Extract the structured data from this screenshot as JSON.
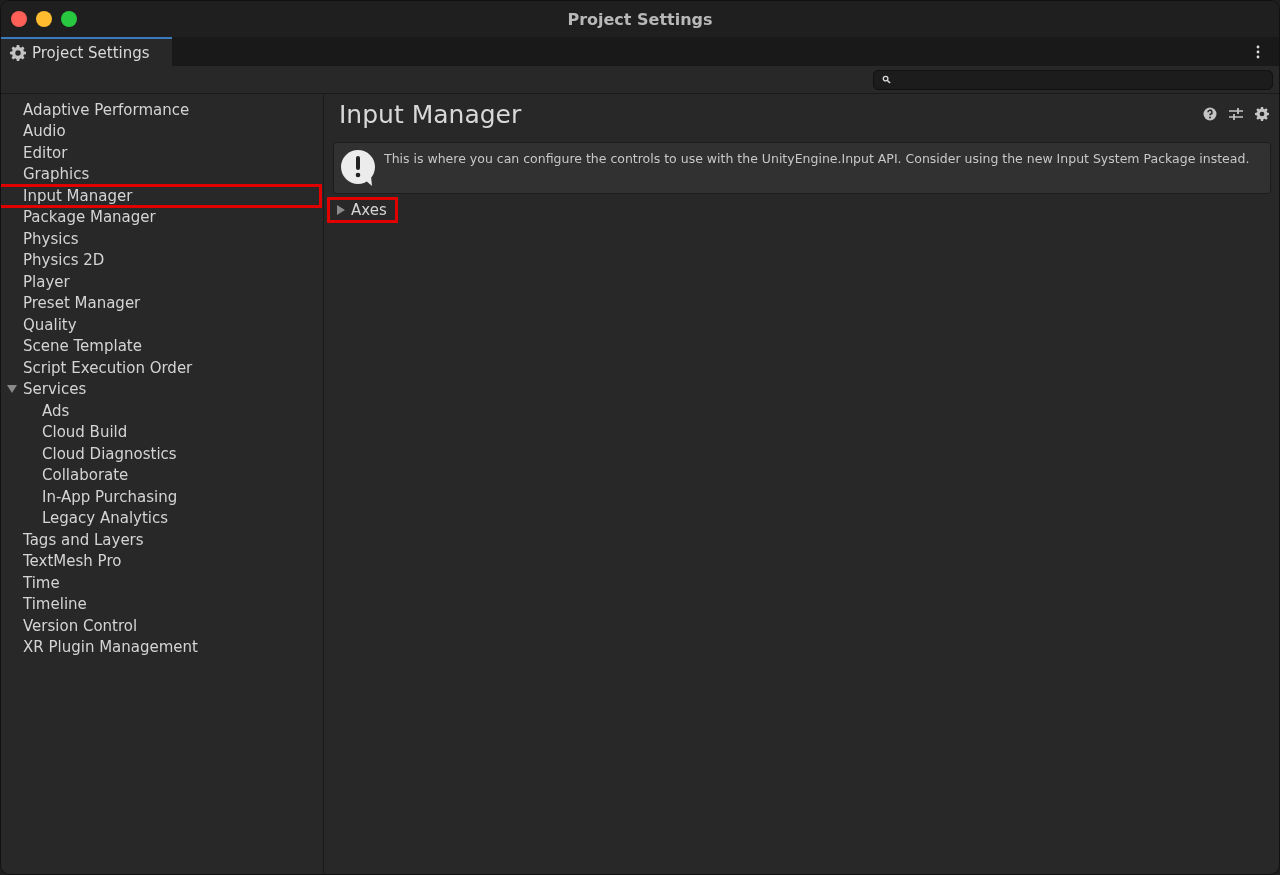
{
  "window": {
    "title": "Project Settings"
  },
  "tab": {
    "label": "Project Settings",
    "selected": true
  },
  "sidebar": {
    "items": [
      {
        "label": "Adaptive Performance",
        "highlighted": false
      },
      {
        "label": "Audio",
        "highlighted": false
      },
      {
        "label": "Editor",
        "highlighted": false
      },
      {
        "label": "Graphics",
        "highlighted": false
      },
      {
        "label": "Input Manager",
        "highlighted": true
      },
      {
        "label": "Package Manager",
        "highlighted": false
      },
      {
        "label": "Physics",
        "highlighted": false
      },
      {
        "label": "Physics 2D",
        "highlighted": false
      },
      {
        "label": "Player",
        "highlighted": false
      },
      {
        "label": "Preset Manager",
        "highlighted": false
      },
      {
        "label": "Quality",
        "highlighted": false
      },
      {
        "label": "Scene Template",
        "highlighted": false
      },
      {
        "label": "Script Execution Order",
        "highlighted": false
      },
      {
        "label": "Services",
        "highlighted": false,
        "expanded": true,
        "children": [
          {
            "label": "Ads",
            "highlighted": false
          },
          {
            "label": "Cloud Build",
            "highlighted": false
          },
          {
            "label": "Cloud Diagnostics",
            "highlighted": false
          },
          {
            "label": "Collaborate",
            "highlighted": false
          },
          {
            "label": "In-App Purchasing",
            "highlighted": false
          },
          {
            "label": "Legacy Analytics",
            "highlighted": false
          }
        ]
      },
      {
        "label": "Tags and Layers",
        "highlighted": false
      },
      {
        "label": "TextMesh Pro",
        "highlighted": false
      },
      {
        "label": "Time",
        "highlighted": false
      },
      {
        "label": "Timeline",
        "highlighted": false
      },
      {
        "label": "Version Control",
        "highlighted": false
      },
      {
        "label": "XR Plugin Management",
        "highlighted": false
      }
    ]
  },
  "panel": {
    "title": "Input Manager",
    "info": "This is where you can configure the controls to use with the UnityEngine.Input API. Consider using the new Input System Package instead.",
    "foldout": {
      "label": "Axes",
      "expanded": false,
      "highlighted": true
    }
  }
}
